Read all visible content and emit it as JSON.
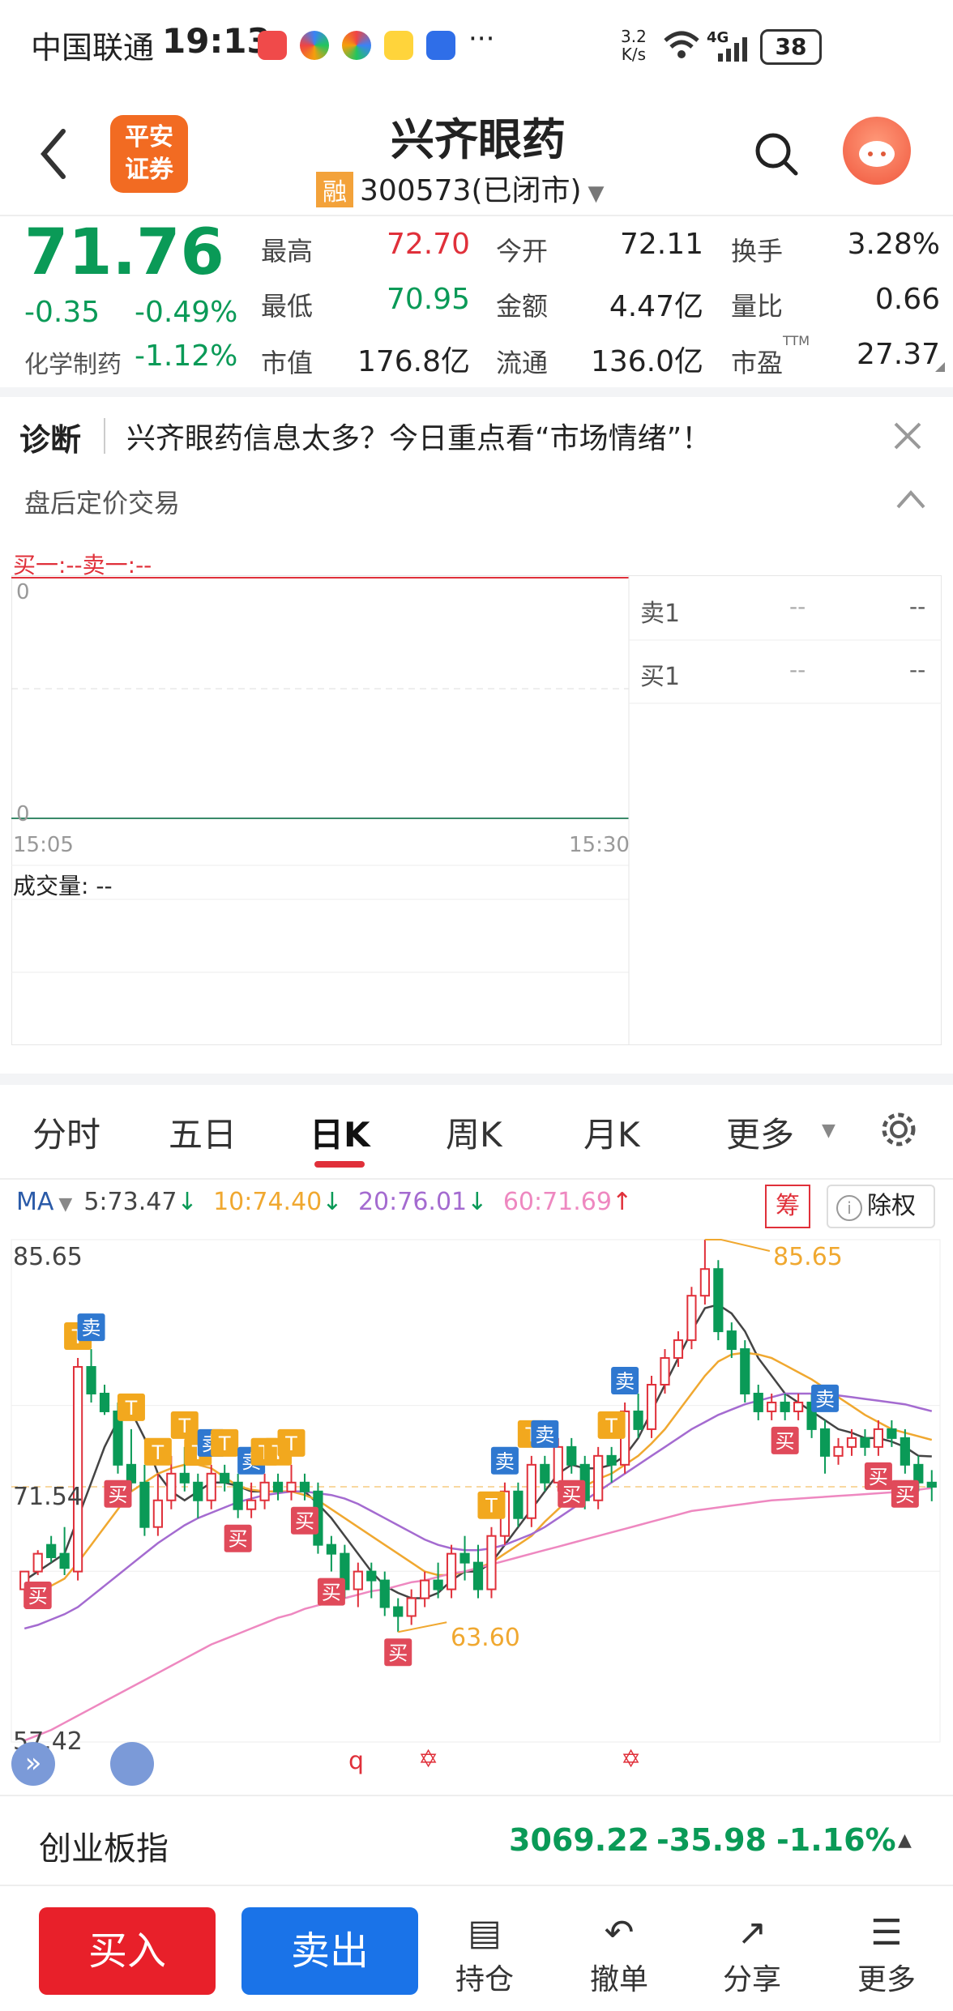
{
  "status_bar": {
    "carrier": "中国联通",
    "time": "19:13",
    "more_dots": "···",
    "net_speed_value": "3.2",
    "net_speed_unit": "K/s",
    "signal": "4G",
    "battery": "38"
  },
  "header": {
    "logo_line1": "平安",
    "logo_line2": "证券",
    "stock_name": "兴齐眼药",
    "margin_badge": "融",
    "stock_code": "300573",
    "market_status": "(已闭市)"
  },
  "quote": {
    "price": "71.76",
    "change": "-0.35",
    "change_pct": "-0.49%",
    "sector": "化学制药",
    "sector_change": "-1.12%",
    "high_label": "最高",
    "high": "72.70",
    "low_label": "最低",
    "low": "70.95",
    "mktcap_label": "市值",
    "mktcap": "176.8亿",
    "open_label": "今开",
    "open": "72.11",
    "amount_label": "金额",
    "amount": "4.47亿",
    "float_label": "流通",
    "float": "136.0亿",
    "turnover_label": "换手",
    "turnover": "3.28%",
    "vol_ratio_label": "量比",
    "vol_ratio": "0.66",
    "pe_label": "市盈",
    "pe_tag": "TTM",
    "pe": "27.37"
  },
  "diagnosis": {
    "label": "诊断",
    "text": "兴齐眼药信息太多？今日重点看“市场情绪”！"
  },
  "after_hours": {
    "title": "盘后定价交易",
    "bid_ask": "买一:--卖一:--",
    "axis_top": "0",
    "axis_bottom": "0",
    "time_start": "15:05",
    "time_end": "15:30",
    "volume": "成交量: --",
    "sell1_label": "卖1",
    "sell1_price": "--",
    "sell1_vol": "--",
    "buy1_label": "买1",
    "buy1_price": "--",
    "buy1_vol": "--"
  },
  "chart_tabs": [
    "分时",
    "五日",
    "日K",
    "周K",
    "月K",
    "更多"
  ],
  "active_tab": "日K",
  "ma": {
    "label": "MA",
    "ma5": "5:73.47",
    "ma10": "10:74.40",
    "ma20": "20:76.01",
    "ma60": "60:71.69",
    "chip_label": "筹",
    "adjust_label": "除权"
  },
  "kchart_axis": {
    "top": "85.65",
    "mid": "71.54",
    "bottom": "57.42",
    "max_label": "85.65",
    "min_label": "63.60"
  },
  "colors": {
    "up": "#e0303a",
    "down": "#0a9a57",
    "ma5": "#444444",
    "ma10": "#f0a830",
    "ma20": "#a46bd0",
    "ma60": "#ee88c0",
    "buy_button": "#e8202a",
    "sell_button": "#1a73e8"
  },
  "chart_data": {
    "type": "candlestick",
    "ylim": [
      57.42,
      85.65
    ],
    "max_label": "85.65",
    "min_label": "63.60",
    "candles": [
      [
        66.0,
        67.0,
        66.5,
        65.0
      ],
      [
        67.0,
        68.0,
        68.2,
        66.8
      ],
      [
        68.5,
        67.8,
        69.0,
        67.5
      ],
      [
        68.0,
        67.2,
        69.5,
        66.8
      ],
      [
        67.0,
        78.5,
        79.0,
        66.5
      ],
      [
        78.5,
        77.0,
        79.5,
        76.5
      ],
      [
        77.0,
        76.0,
        77.5,
        75.8
      ],
      [
        76.0,
        73.0,
        76.5,
        72.5
      ],
      [
        73.0,
        72.0,
        75.0,
        71.5
      ],
      [
        72.0,
        69.5,
        73.0,
        69.0
      ],
      [
        69.5,
        71.0,
        72.5,
        69.0
      ],
      [
        71.0,
        72.5,
        73.5,
        70.5
      ],
      [
        72.5,
        72.0,
        74.0,
        71.5
      ],
      [
        72.0,
        71.0,
        72.5,
        70.0
      ],
      [
        71.0,
        72.5,
        73.0,
        70.5
      ],
      [
        72.5,
        72.0,
        73.0,
        71.5
      ],
      [
        72.0,
        70.5,
        72.5,
        70.0
      ],
      [
        70.5,
        71.0,
        72.0,
        70.0
      ],
      [
        71.0,
        72.0,
        72.5,
        70.5
      ],
      [
        72.0,
        71.5,
        72.5,
        71.0
      ],
      [
        71.5,
        72.0,
        73.0,
        71.0
      ],
      [
        72.0,
        71.5,
        72.5,
        71.0
      ],
      [
        71.5,
        68.5,
        72.0,
        68.0
      ],
      [
        68.5,
        68.0,
        69.0,
        67.0
      ],
      [
        68.0,
        66.0,
        68.5,
        65.5
      ],
      [
        66.0,
        67.0,
        67.5,
        65.0
      ],
      [
        67.0,
        66.5,
        67.5,
        65.5
      ],
      [
        66.5,
        65.0,
        67.0,
        64.5
      ],
      [
        65.0,
        64.5,
        65.5,
        63.6
      ],
      [
        64.5,
        65.5,
        66.0,
        64.0
      ],
      [
        65.5,
        66.5,
        67.0,
        65.0
      ],
      [
        66.5,
        66.0,
        67.5,
        65.5
      ],
      [
        66.0,
        68.0,
        68.5,
        65.5
      ],
      [
        68.0,
        67.5,
        69.0,
        66.5
      ],
      [
        67.5,
        66.0,
        68.5,
        65.5
      ],
      [
        66.0,
        69.0,
        69.5,
        65.5
      ],
      [
        69.0,
        71.5,
        72.0,
        68.5
      ],
      [
        71.5,
        70.0,
        72.0,
        69.5
      ],
      [
        70.0,
        73.0,
        73.5,
        69.5
      ],
      [
        73.0,
        72.0,
        73.5,
        71.5
      ],
      [
        72.0,
        74.0,
        74.5,
        71.5
      ],
      [
        74.0,
        73.0,
        74.5,
        72.5
      ],
      [
        73.0,
        71.0,
        73.5,
        70.5
      ],
      [
        71.0,
        73.5,
        74.0,
        70.5
      ],
      [
        73.5,
        73.0,
        74.0,
        72.0
      ],
      [
        73.0,
        76.0,
        76.5,
        72.5
      ],
      [
        76.0,
        75.0,
        77.0,
        74.5
      ],
      [
        75.0,
        77.5,
        78.0,
        74.5
      ],
      [
        77.5,
        79.0,
        79.5,
        77.0
      ],
      [
        79.0,
        80.0,
        80.5,
        78.5
      ],
      [
        80.0,
        82.5,
        83.0,
        79.5
      ],
      [
        82.5,
        84.0,
        85.65,
        82.0
      ],
      [
        84.0,
        80.5,
        84.5,
        80.0
      ],
      [
        80.5,
        79.5,
        81.0,
        79.0
      ],
      [
        79.5,
        77.0,
        80.0,
        76.5
      ],
      [
        77.0,
        76.0,
        77.5,
        75.5
      ],
      [
        76.0,
        76.5,
        77.0,
        75.5
      ],
      [
        76.5,
        76.0,
        77.0,
        75.5
      ],
      [
        76.0,
        76.5,
        77.0,
        75.5
      ],
      [
        76.5,
        75.0,
        77.0,
        74.5
      ],
      [
        75.0,
        73.5,
        75.5,
        72.5
      ],
      [
        73.5,
        74.0,
        74.5,
        73.0
      ],
      [
        74.0,
        74.5,
        75.0,
        73.5
      ],
      [
        74.5,
        74.0,
        75.0,
        73.5
      ],
      [
        74.0,
        75.0,
        75.5,
        73.5
      ],
      [
        75.0,
        74.5,
        75.5,
        74.0
      ],
      [
        74.5,
        73.0,
        75.0,
        72.5
      ],
      [
        73.0,
        72.0,
        73.5,
        71.5
      ],
      [
        72.0,
        71.76,
        72.7,
        70.95
      ]
    ],
    "series": [
      {
        "name": "5",
        "values": [
          66.5,
          67.0,
          67.5,
          68.0,
          70.0,
          72.0,
          74.0,
          75.5,
          76.0,
          74.5,
          72.5,
          71.5,
          71.0,
          71.5,
          72.0,
          72.0,
          71.8,
          71.5,
          71.5,
          71.5,
          71.5,
          71.5,
          70.8,
          70.0,
          69.0,
          68.0,
          67.0,
          66.2,
          65.8,
          65.5,
          65.5,
          65.8,
          66.5,
          67.0,
          67.0,
          67.5,
          68.5,
          69.5,
          70.5,
          71.5,
          72.5,
          73.0,
          72.8,
          72.8,
          73.0,
          73.5,
          74.5,
          76.0,
          77.5,
          79.0,
          80.5,
          81.8,
          82.0,
          81.5,
          80.5,
          79.0,
          78.0,
          77.0,
          76.5,
          76.0,
          75.5,
          75.0,
          74.8,
          74.5,
          74.5,
          74.3,
          74.0,
          73.5,
          73.47
        ]
      },
      {
        "name": "10",
        "values": [
          65.5,
          65.8,
          66.2,
          66.6,
          67.5,
          68.5,
          69.5,
          70.5,
          71.5,
          72.0,
          72.5,
          72.8,
          73.0,
          73.0,
          72.8,
          72.3,
          71.8,
          71.6,
          71.5,
          71.5,
          71.5,
          71.3,
          71.0,
          70.5,
          70.0,
          69.5,
          69.0,
          68.5,
          68.0,
          67.5,
          67.0,
          66.8,
          66.8,
          67.0,
          67.2,
          67.5,
          68.0,
          68.5,
          69.0,
          69.8,
          70.5,
          71.2,
          71.8,
          72.2,
          72.5,
          73.0,
          73.5,
          74.2,
          75.0,
          76.0,
          77.0,
          78.0,
          78.8,
          79.2,
          79.3,
          79.2,
          79.0,
          78.6,
          78.2,
          77.8,
          77.3,
          76.8,
          76.3,
          75.8,
          75.4,
          75.0,
          74.8,
          74.6,
          74.4
        ]
      },
      {
        "name": "20",
        "values": [
          63.8,
          64.0,
          64.3,
          64.6,
          65.0,
          65.6,
          66.2,
          66.8,
          67.4,
          68.0,
          68.6,
          69.1,
          69.6,
          70.0,
          70.3,
          70.6,
          70.9,
          71.1,
          71.3,
          71.4,
          71.5,
          71.5,
          71.4,
          71.3,
          71.1,
          70.8,
          70.4,
          70.0,
          69.6,
          69.2,
          68.8,
          68.5,
          68.3,
          68.2,
          68.2,
          68.3,
          68.5,
          68.8,
          69.1,
          69.5,
          70.0,
          70.5,
          71.0,
          71.5,
          72.0,
          72.5,
          73.0,
          73.5,
          74.0,
          74.5,
          75.0,
          75.4,
          75.8,
          76.1,
          76.4,
          76.6,
          76.8,
          77.0,
          77.0,
          77.0,
          77.0,
          76.9,
          76.8,
          76.7,
          76.6,
          76.5,
          76.4,
          76.2,
          76.01
        ]
      },
      {
        "name": "60",
        "values": [
          57.5,
          57.8,
          58.1,
          58.5,
          58.9,
          59.3,
          59.7,
          60.1,
          60.5,
          60.9,
          61.3,
          61.7,
          62.1,
          62.5,
          62.9,
          63.2,
          63.5,
          63.8,
          64.1,
          64.4,
          64.6,
          64.9,
          65.1,
          65.3,
          65.5,
          65.7,
          65.9,
          66.0,
          66.2,
          66.4,
          66.5,
          66.7,
          66.9,
          67.0,
          67.2,
          67.4,
          67.6,
          67.8,
          68.0,
          68.2,
          68.4,
          68.6,
          68.8,
          69.0,
          69.2,
          69.4,
          69.6,
          69.8,
          70.0,
          70.2,
          70.4,
          70.5,
          70.6,
          70.7,
          70.8,
          70.9,
          71.0,
          71.05,
          71.1,
          71.15,
          71.2,
          71.25,
          71.3,
          71.35,
          71.4,
          71.45,
          71.5,
          71.6,
          71.69
        ]
      }
    ],
    "signals": [
      {
        "i": 1,
        "t": "买",
        "kind": "buy"
      },
      {
        "i": 4,
        "t": "T",
        "kind": "t"
      },
      {
        "i": 5,
        "t": "卖",
        "kind": "sell"
      },
      {
        "i": 7,
        "t": "买",
        "kind": "buy"
      },
      {
        "i": 8,
        "t": "T",
        "kind": "t"
      },
      {
        "i": 10,
        "t": "T",
        "kind": "t"
      },
      {
        "i": 12,
        "t": "T",
        "kind": "t"
      },
      {
        "i": 13,
        "t": "T",
        "kind": "t"
      },
      {
        "i": 14,
        "t": "卖",
        "kind": "sell"
      },
      {
        "i": 15,
        "t": "T",
        "kind": "t"
      },
      {
        "i": 16,
        "t": "买",
        "kind": "buy"
      },
      {
        "i": 17,
        "t": "卖",
        "kind": "sell"
      },
      {
        "i": 18,
        "t": "T",
        "kind": "t"
      },
      {
        "i": 19,
        "t": "T",
        "kind": "t"
      },
      {
        "i": 20,
        "t": "T",
        "kind": "t"
      },
      {
        "i": 21,
        "t": "买",
        "kind": "buy"
      },
      {
        "i": 23,
        "t": "买",
        "kind": "buy"
      },
      {
        "i": 28,
        "t": "买",
        "kind": "buy"
      },
      {
        "i": 35,
        "t": "T",
        "kind": "t"
      },
      {
        "i": 36,
        "t": "卖",
        "kind": "sell"
      },
      {
        "i": 38,
        "t": "T",
        "kind": "t"
      },
      {
        "i": 39,
        "t": "卖",
        "kind": "sell"
      },
      {
        "i": 41,
        "t": "买",
        "kind": "buy"
      },
      {
        "i": 44,
        "t": "T",
        "kind": "t"
      },
      {
        "i": 45,
        "t": "卖",
        "kind": "sell"
      },
      {
        "i": 57,
        "t": "买",
        "kind": "buy"
      },
      {
        "i": 60,
        "t": "卖",
        "kind": "sell"
      },
      {
        "i": 64,
        "t": "买",
        "kind": "buy"
      },
      {
        "i": 66,
        "t": "买",
        "kind": "buy"
      }
    ]
  },
  "index_bar": {
    "name": "创业板指",
    "value": "3069.22",
    "change": "-35.98",
    "change_pct": "-1.16%"
  },
  "bottom_bar": {
    "buy": "买入",
    "sell": "卖出",
    "holdings": "持仓",
    "cancel": "撤单",
    "share": "分享",
    "more": "更多"
  }
}
